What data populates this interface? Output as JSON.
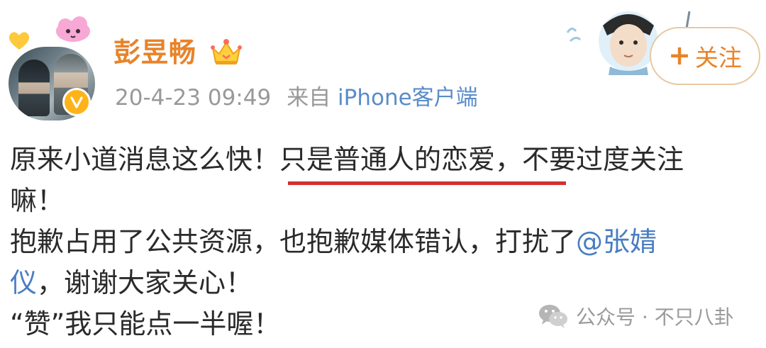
{
  "user": {
    "name": "彭昱畅",
    "timestamp": "20-4-23 09:49",
    "source_prefix": "来自",
    "client": "iPhone客户端"
  },
  "follow_button": {
    "plus": "+",
    "label": "关注"
  },
  "post": {
    "line1_a": "原来小道消息这么快！",
    "line1_b": "只是普通人的恋爱，",
    "line1_c": "不要过度关注",
    "line2": "嘛！",
    "line3_a": "抱歉占用了公共资源，也抱歉媒体错认，打扰了",
    "line3_mention": "@张婧",
    "line4_mention": "仪",
    "line4_b": "，谢谢大家关心！",
    "line5": "“赞”我只能点一半喔！"
  },
  "watermark": {
    "text": "公众号 · 不只八卦"
  },
  "colors": {
    "name": "#e8832a",
    "meta": "#999999",
    "client_link": "#5a8cc8",
    "mention": "#4a7dc1",
    "underline": "#d3302f",
    "follow_border": "#e8c9a0"
  },
  "icons": {
    "crown": "vip-crown-icon",
    "verify": "verified-badge-icon",
    "wechat": "wechat-logo-icon"
  }
}
